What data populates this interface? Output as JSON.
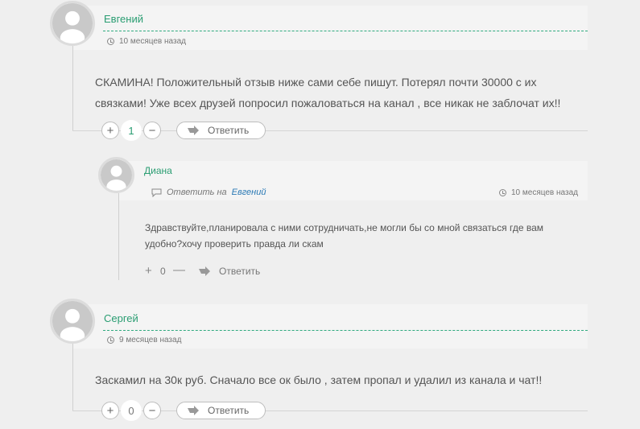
{
  "comments": [
    {
      "author": "Евгений",
      "time": "10 месяцев назад",
      "text_line1": "СКАМИНА! Положительный отзыв ниже сами себе пишут. Потерял почти 30000 с их",
      "text_line2": "связками! Уже всех друзей попросил пожаловаться на канал , все никак не заблочат их!!",
      "plus": "+",
      "minus": "−",
      "votes": "1",
      "reply_label": "Ответить"
    },
    {
      "author": "Диана",
      "reply_prefix": "Ответить на",
      "reply_to": "Евгений",
      "time": "10 месяцев назад",
      "text_line1": "Здравствуйте,планировала с ними сотрудничать,не могли бы со мной связаться где вам",
      "text_line2": "удобно?хочу проверить правда ли скам",
      "plus": "+",
      "minus": "—",
      "votes": "0",
      "reply_label": "Ответить"
    },
    {
      "author": "Сергей",
      "time": "9 месяцев назад",
      "text_line1": "Заскамил на 30к руб. Сначало все ок было , затем пропал и удалил из канала и чат!!",
      "plus": "+",
      "minus": "−",
      "votes": "0",
      "reply_label": "Ответить"
    }
  ],
  "colors": {
    "accent": "#2a9d72",
    "link": "#2a79b5",
    "background": "#efefef"
  },
  "icons": [
    "avatar-placeholder",
    "clock-icon",
    "reply-arrow-icon",
    "comment-icon"
  ]
}
